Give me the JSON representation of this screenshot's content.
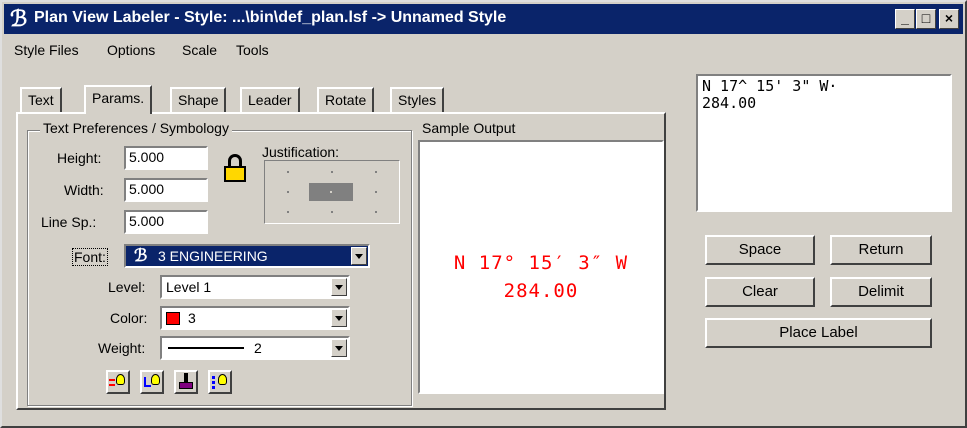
{
  "window": {
    "title": "Plan View Labeler - Style: ...\\bin\\def_plan.lsf -> Unnamed Style",
    "app_icon": "microstation-icon",
    "controls": {
      "minimize": "_",
      "maximize": "□",
      "close": "×"
    }
  },
  "menu": [
    "Style Files",
    "Options",
    "Scale",
    "Tools"
  ],
  "tabs": [
    "Text",
    "Params.",
    "Shape",
    "Leader",
    "Rotate",
    "Styles"
  ],
  "active_tab": "Params.",
  "text_prefs": {
    "group_title": "Text Preferences / Symbology",
    "height_label": "Height:",
    "height_value": "5.000",
    "width_label": "Width:",
    "width_value": "5.000",
    "linesp_label": "Line Sp.:",
    "linesp_value": "5.000",
    "lock_icon": "lock-icon",
    "justification_label": "Justification:",
    "font_label": "Font:",
    "font_value": "3 ENGINEERING",
    "level_label": "Level:",
    "level_value": "Level 1",
    "color_label": "Color:",
    "color_value": "3",
    "color_swatch": "#ff0000",
    "weight_label": "Weight:",
    "weight_value": "2",
    "icons": [
      "match-text-icon",
      "level-bulb-icon",
      "paintbrush-icon",
      "select-bulb-icon"
    ]
  },
  "sample": {
    "title": "Sample Output",
    "line1": "N 17° 15′ 3″ W",
    "line2": "284.00",
    "color": "#ff0000"
  },
  "label_text": {
    "line1": "N 17^ 15' 3\" W·",
    "line2": "284.00"
  },
  "buttons": {
    "space": "Space",
    "return": "Return",
    "clear": "Clear",
    "delimit": "Delimit",
    "place_label": "Place Label"
  },
  "colors": {
    "titlebar": "#0a246a",
    "face": "#d4d0c8",
    "selection": "#0a246a"
  }
}
